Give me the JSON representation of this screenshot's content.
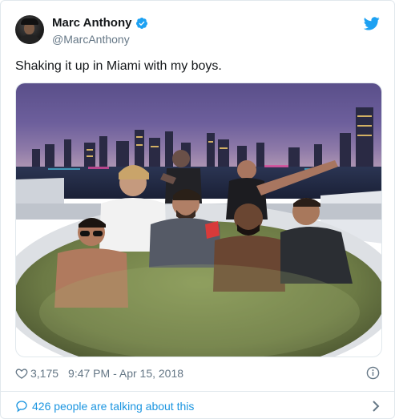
{
  "author": {
    "name": "Marc Anthony",
    "handle": "@MarcAnthony",
    "verified": true
  },
  "icons": {
    "avatar": "profile-photo",
    "verified": "verified-badge-icon",
    "brand": "twitter-bird-icon",
    "like": "heart-icon",
    "info": "info-icon",
    "conversation": "speech-bubble-icon",
    "navigate": "chevron-right-icon"
  },
  "tweet": {
    "text": "Shaking it up in Miami with my boys."
  },
  "media": {
    "alt": "Photo of friends in a hot tub on a yacht with the Miami skyline at night"
  },
  "meta": {
    "likes": "3,175",
    "timestamp": "9:47 PM - Apr 15, 2018"
  },
  "footer": {
    "talking": "426 people are talking about this"
  },
  "colors": {
    "brand": "#1da1f2",
    "link": "#1b95e0",
    "muted": "#657786",
    "text": "#14171a",
    "border": "#e1e8ed"
  }
}
